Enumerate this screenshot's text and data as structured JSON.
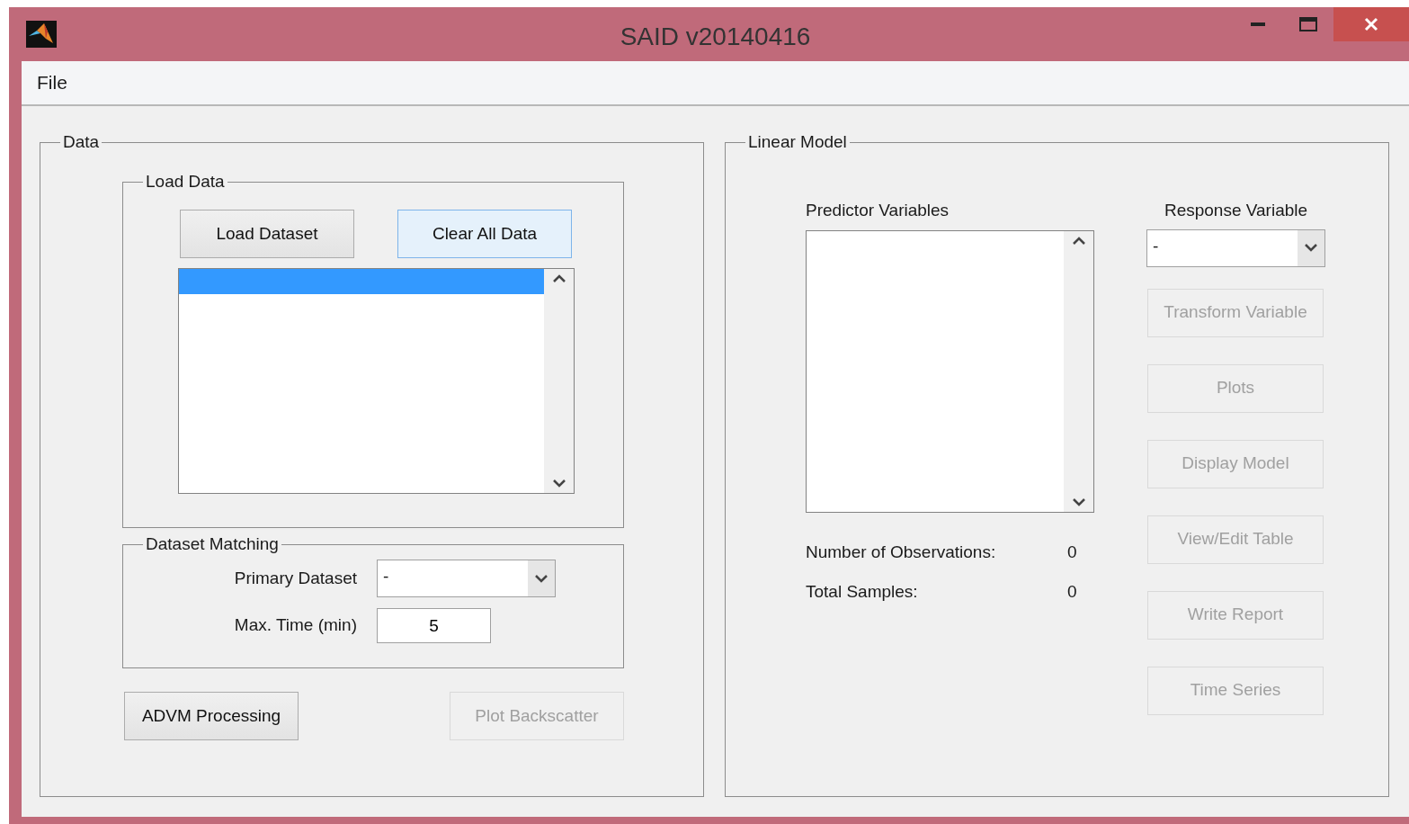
{
  "window": {
    "title": "SAID v20140416"
  },
  "menu": [
    {
      "label": "File"
    }
  ],
  "data_panel": {
    "title": "Data",
    "load_data": {
      "title": "Load Data",
      "buttons": [
        {
          "label": "Load Dataset",
          "focused": false
        },
        {
          "label": "Clear All Data",
          "focused": true
        }
      ],
      "dataset_list": {
        "rows": [
          {
            "selected": true
          }
        ]
      }
    },
    "dataset_matching": {
      "title": "Dataset Matching",
      "primary_dataset": {
        "label": "Primary Dataset",
        "value": "-"
      },
      "max_time": {
        "label": "Max. Time (min)",
        "value": "5"
      }
    },
    "buttons": [
      {
        "label": "ADVM Processing",
        "disabled": false
      },
      {
        "label": "Plot Backscatter",
        "disabled": true
      }
    ]
  },
  "linear_model": {
    "title": "Linear Model",
    "predictor_label": "Predictor Variables",
    "response_label": "Response Variable",
    "response_value": "-",
    "stats": [
      {
        "label": "Number of Observations:",
        "value": "0"
      },
      {
        "label": "Total Samples:",
        "value": "0"
      }
    ],
    "buttons": [
      {
        "label": "Transform Variable",
        "disabled": true
      },
      {
        "label": "Plots",
        "disabled": true
      },
      {
        "label": "Display Model",
        "disabled": true
      },
      {
        "label": "View/Edit Table",
        "disabled": true
      },
      {
        "label": "Write Report",
        "disabled": true
      },
      {
        "label": "Time Series",
        "disabled": true
      }
    ]
  }
}
